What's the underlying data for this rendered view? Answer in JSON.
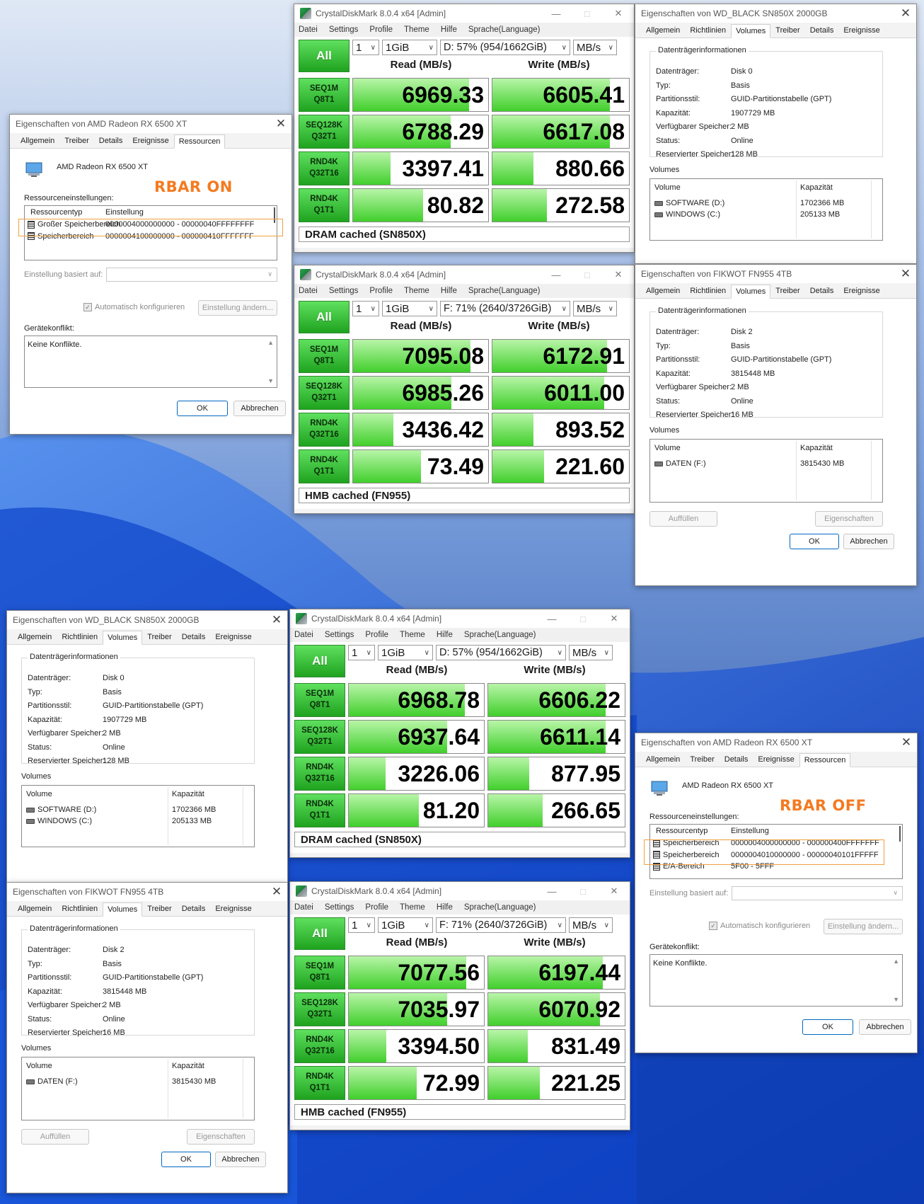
{
  "cdm": {
    "title": "CrystalDiskMark 8.0.4 x64 [Admin]",
    "menu": [
      "Datei",
      "Settings",
      "Profile",
      "Theme",
      "Hilfe",
      "Sprache(Language)"
    ],
    "all_label": "All",
    "count": "1",
    "size": "1GiB",
    "unit": "MB/s",
    "read_header": "Read (MB/s)",
    "write_header": "Write (MB/s)",
    "tests": [
      {
        "l1": "SEQ1M",
        "l2": "Q8T1"
      },
      {
        "l1": "SEQ128K",
        "l2": "Q32T1"
      },
      {
        "l1": "RND4K",
        "l2": "Q32T16"
      },
      {
        "l1": "RND4K",
        "l2": "Q1T1"
      }
    ],
    "windows": [
      {
        "drive": "D: 57% (954/1662GiB)",
        "comment": "DRAM cached (SN850X)",
        "read": [
          "6969.33",
          "6788.29",
          "3397.41",
          "80.82"
        ],
        "write": [
          "6605.41",
          "6617.08",
          "880.66",
          "272.58"
        ],
        "read_fill": [
          0.86,
          0.72,
          0.28,
          0.52
        ],
        "write_fill": [
          0.86,
          0.86,
          0.3,
          0.4
        ]
      },
      {
        "drive": "F: 71% (2640/3726GiB)",
        "comment": "HMB cached (FN955)",
        "read": [
          "7095.08",
          "6985.26",
          "3436.42",
          "73.49"
        ],
        "write": [
          "6172.91",
          "6011.00",
          "893.52",
          "221.60"
        ],
        "read_fill": [
          0.87,
          0.73,
          0.3,
          0.5
        ],
        "write_fill": [
          0.84,
          0.82,
          0.3,
          0.38
        ]
      },
      {
        "drive": "D: 57% (954/1662GiB)",
        "comment": "DRAM cached (SN850X)",
        "read": [
          "6968.78",
          "6937.64",
          "3226.06",
          "81.20"
        ],
        "write": [
          "6606.22",
          "6611.14",
          "877.95",
          "266.65"
        ],
        "read_fill": [
          0.86,
          0.73,
          0.27,
          0.52
        ],
        "write_fill": [
          0.86,
          0.86,
          0.3,
          0.4
        ]
      },
      {
        "drive": "F: 71% (2640/3726GiB)",
        "comment": "HMB cached (FN955)",
        "read": [
          "7077.56",
          "7035.97",
          "3394.50",
          "72.99"
        ],
        "write": [
          "6197.44",
          "6070.92",
          "831.49",
          "221.25"
        ],
        "read_fill": [
          0.87,
          0.73,
          0.28,
          0.5
        ],
        "write_fill": [
          0.84,
          0.82,
          0.29,
          0.38
        ]
      }
    ]
  },
  "disk_tabs": [
    "Allgemein",
    "Richtlinien",
    "Volumes",
    "Treiber",
    "Details",
    "Ereignisse"
  ],
  "disk_labels": {
    "group": "Datenträgerinformationen",
    "rows": [
      "Datenträger:",
      "Typ:",
      "Partitionsstil:",
      "Kapazität:",
      "Verfügbarer Speicher:",
      "Status:",
      "Reservierter Speicher:"
    ],
    "volumes": "Volumes",
    "col_volume": "Volume",
    "col_capacity": "Kapazität",
    "btn_fill": "Auffüllen",
    "btn_props": "Eigenschaften",
    "ok": "OK",
    "cancel": "Abbrechen"
  },
  "sn850x": {
    "title": "Eigenschaften von WD_BLACK SN850X 2000GB",
    "values": [
      "Disk 0",
      "Basis",
      "GUID-Partitionstabelle (GPT)",
      "1907729 MB",
      "2 MB",
      "Online",
      "128 MB"
    ],
    "volumes": [
      {
        "name": "SOFTWARE (D:)",
        "cap": "1702366 MB"
      },
      {
        "name": "WINDOWS (C:)",
        "cap": "205133 MB"
      }
    ]
  },
  "fn955": {
    "title": "Eigenschaften von FIKWOT FN955 4TB",
    "values": [
      "Disk 2",
      "Basis",
      "GUID-Partitionstabelle (GPT)",
      "3815448 MB",
      "2 MB",
      "Online",
      "16 MB"
    ],
    "volumes": [
      {
        "name": "DATEN (F:)",
        "cap": "3815430 MB"
      }
    ]
  },
  "gpu": {
    "title": "Eigenschaften von AMD Radeon RX 6500 XT",
    "tabs": [
      "Allgemein",
      "Treiber",
      "Details",
      "Ereignisse",
      "Ressourcen"
    ],
    "device": "AMD Radeon RX 6500 XT",
    "settings_label": "Ressourceneinstellungen:",
    "col_type": "Ressourcentyp",
    "col_setting": "Einstellung",
    "based_on": "Einstellung basiert auf:",
    "auto": "Automatisch konfigurieren",
    "change": "Einstellung ändern...",
    "conflict_label": "Gerätekonflikt:",
    "conflict_text": "Keine Konflikte.",
    "ok": "OK",
    "cancel": "Abbrechen",
    "on": {
      "badge": "RBAR ON",
      "rows": [
        {
          "type": "Großer Speicherbereich",
          "value": "0000004000000000 - 00000040FFFFFFFF"
        },
        {
          "type": "Speicherbereich",
          "value": "0000004100000000 - 000000410FFFFFFF"
        }
      ]
    },
    "off": {
      "badge": "RBAR OFF",
      "rows": [
        {
          "type": "Speicherbereich",
          "value": "0000004000000000 - 000000400FFFFFFF"
        },
        {
          "type": "Speicherbereich",
          "value": "0000004010000000 - 00000040101FFFFF"
        },
        {
          "type": "E/A-Bereich",
          "value": "5F00 - 5FFF"
        }
      ]
    }
  },
  "colors": {
    "accent_green": "#1fa31f",
    "rbar_orange": "#f47a20",
    "highlight_orange": "#f0a040"
  }
}
